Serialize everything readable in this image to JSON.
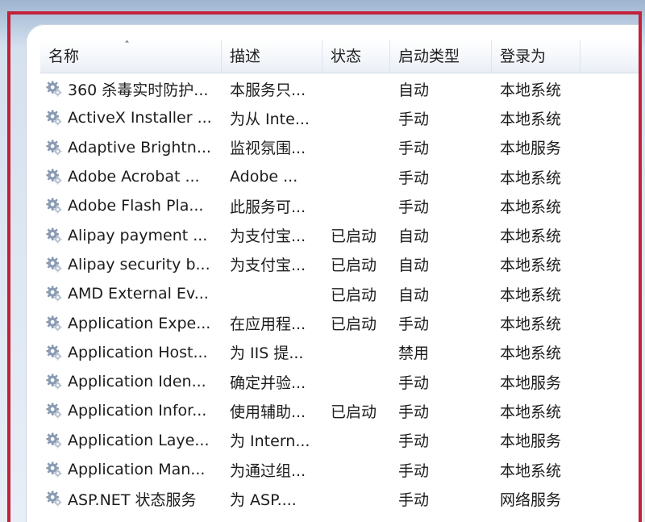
{
  "columns": {
    "name": "名称",
    "sort_indicator": "ˆ",
    "description": "描述",
    "status": "状态",
    "startup_type": "启动类型",
    "logon_as": "登录为"
  },
  "colors": {
    "highlight_border": "#c2213a",
    "gear_icon": "#8a9bb3"
  },
  "services": [
    {
      "name": "360 杀毒实时防护...",
      "description": "本服务只...",
      "status": "",
      "startup": "自动",
      "logon": "本地系统"
    },
    {
      "name": "ActiveX Installer ...",
      "description": "为从 Inte...",
      "status": "",
      "startup": "手动",
      "logon": "本地系统"
    },
    {
      "name": "Adaptive Brightn...",
      "description": "监视氛围...",
      "status": "",
      "startup": "手动",
      "logon": "本地服务"
    },
    {
      "name": "Adobe Acrobat ...",
      "description": "Adobe ...",
      "status": "",
      "startup": "手动",
      "logon": "本地系统"
    },
    {
      "name": "Adobe Flash Pla...",
      "description": "此服务可...",
      "status": "",
      "startup": "手动",
      "logon": "本地系统"
    },
    {
      "name": "Alipay payment ...",
      "description": "为支付宝...",
      "status": "已启动",
      "startup": "自动",
      "logon": "本地系统"
    },
    {
      "name": "Alipay security b...",
      "description": "为支付宝...",
      "status": "已启动",
      "startup": "自动",
      "logon": "本地系统"
    },
    {
      "name": "AMD External Ev...",
      "description": "",
      "status": "已启动",
      "startup": "自动",
      "logon": "本地系统"
    },
    {
      "name": "Application Expe...",
      "description": "在应用程...",
      "status": "已启动",
      "startup": "手动",
      "logon": "本地系统"
    },
    {
      "name": "Application Host...",
      "description": "为 IIS 提...",
      "status": "",
      "startup": "禁用",
      "logon": "本地系统"
    },
    {
      "name": "Application Iden...",
      "description": "确定并验...",
      "status": "",
      "startup": "手动",
      "logon": "本地服务"
    },
    {
      "name": "Application Infor...",
      "description": "使用辅助...",
      "status": "已启动",
      "startup": "手动",
      "logon": "本地系统"
    },
    {
      "name": "Application Laye...",
      "description": "为 Intern...",
      "status": "",
      "startup": "手动",
      "logon": "本地服务"
    },
    {
      "name": "Application Man...",
      "description": "为通过组...",
      "status": "",
      "startup": "手动",
      "logon": "本地系统"
    },
    {
      "name": "ASP.NET 状态服务",
      "description": "为 ASP....",
      "status": "",
      "startup": "手动",
      "logon": "网络服务"
    }
  ]
}
